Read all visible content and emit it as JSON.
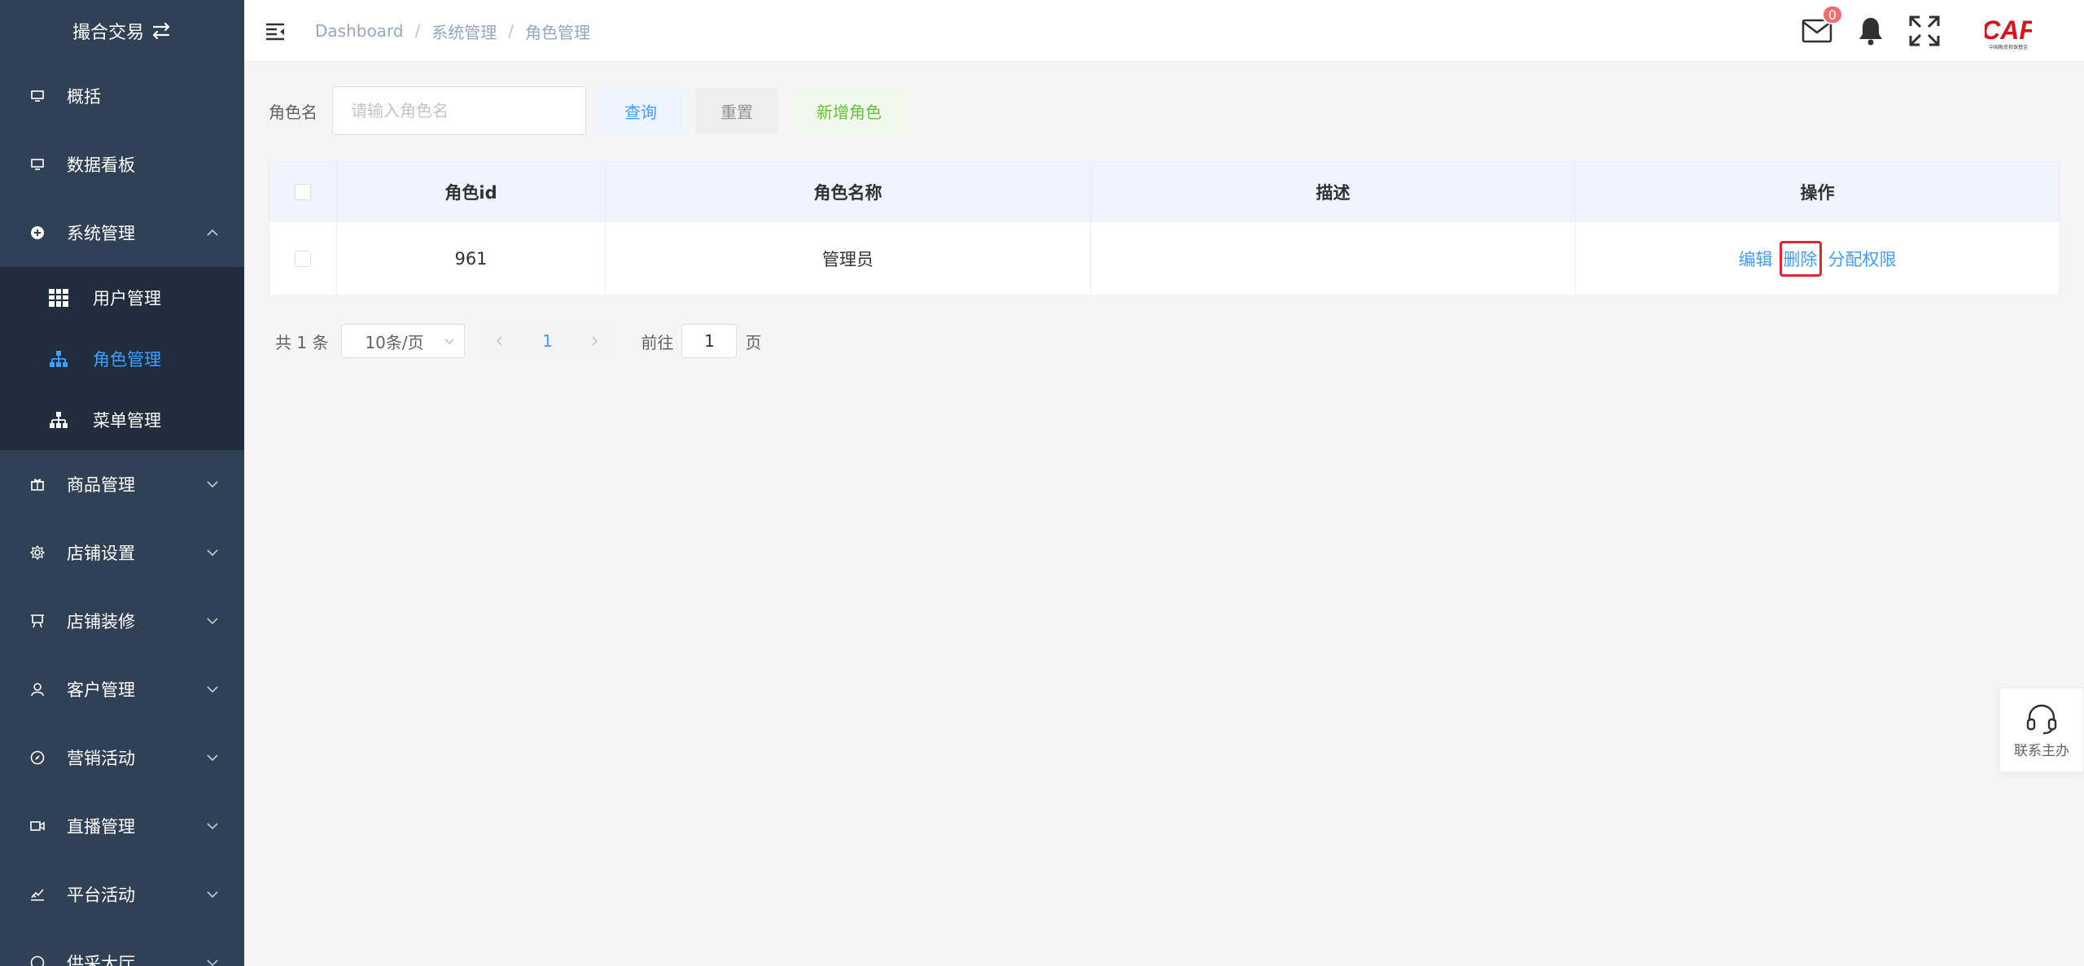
{
  "sidebar": {
    "brand": "撮合交易",
    "items": [
      {
        "label": "概括",
        "icon": "monitor-icon"
      },
      {
        "label": "数据看板",
        "icon": "monitor-icon"
      },
      {
        "label": "系统管理",
        "icon": "plus-circle-icon",
        "expanded": true
      },
      {
        "label": "商品管理",
        "icon": "gift-icon"
      },
      {
        "label": "店铺设置",
        "icon": "gear-icon"
      },
      {
        "label": "店铺装修",
        "icon": "easel-icon"
      },
      {
        "label": "客户管理",
        "icon": "user-icon"
      },
      {
        "label": "营销活动",
        "icon": "compass-icon"
      },
      {
        "label": "直播管理",
        "icon": "video-icon"
      },
      {
        "label": "平台活动",
        "icon": "chart-icon"
      },
      {
        "label": "供采大厅",
        "icon": "hall-icon"
      }
    ],
    "submenu": [
      {
        "label": "用户管理",
        "icon": "grid-icon"
      },
      {
        "label": "角色管理",
        "icon": "org-icon",
        "active": true
      },
      {
        "label": "菜单管理",
        "icon": "org-icon"
      }
    ]
  },
  "header": {
    "breadcrumb": [
      "Dashboard",
      "系统管理",
      "角色管理"
    ],
    "mail_count": "0",
    "logo_text": "CAF",
    "logo_sub": "中国融资担保基金"
  },
  "filter": {
    "label": "角色名",
    "placeholder": "请输入角色名",
    "query_label": "查询",
    "reset_label": "重置",
    "add_label": "新增角色"
  },
  "table": {
    "columns": [
      "角色id",
      "角色名称",
      "描述",
      "操作"
    ],
    "rows": [
      {
        "id": "961",
        "name": "管理员",
        "desc": ""
      }
    ],
    "actions": {
      "edit": "编辑",
      "delete": "删除",
      "assign": "分配权限"
    }
  },
  "pagination": {
    "total_text": "共 1 条",
    "page_size": "10条/页",
    "current_page": "1",
    "goto_label": "前往",
    "goto_value": "1",
    "page_suffix": "页"
  },
  "contact": {
    "label": "联系主办"
  },
  "colors": {
    "sidebar_bg": "#304156",
    "submenu_bg": "#1f2d3d",
    "accent": "#409eff",
    "success": "#67c23a",
    "highlight": "#e3262e"
  }
}
